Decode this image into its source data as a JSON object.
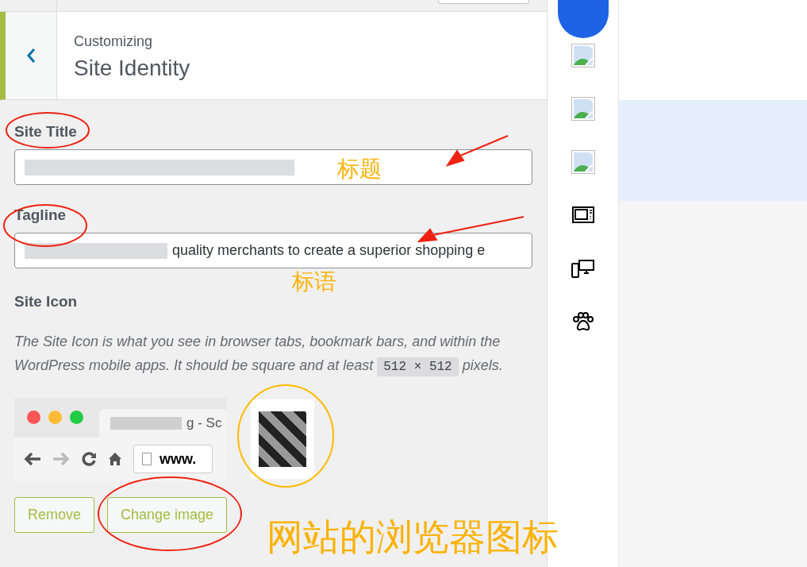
{
  "header": {
    "eyebrow": "Customizing",
    "title": "Site Identity"
  },
  "fields": [
    {
      "label": "Site Title",
      "blurred": true
    },
    {
      "label": "Tagline",
      "blurred": true,
      "value": "quality merchants to create a superior shopping e"
    }
  ],
  "site_icon": {
    "label": "Site Icon",
    "description": "The Site Icon is what you see in browser tabs, bookmark bars, and within the WordPress mobile apps. It should be square and at least",
    "size": "512 × 512",
    "suffix": "pixels.",
    "preview": {
      "tab_title": "g - Sc",
      "address": "www."
    },
    "buttons": [
      "Remove",
      "Change image"
    ]
  },
  "annotations": {
    "title_note": "标题",
    "tagline_note": "标语",
    "icon_note": "网站的浏览器图标"
  }
}
